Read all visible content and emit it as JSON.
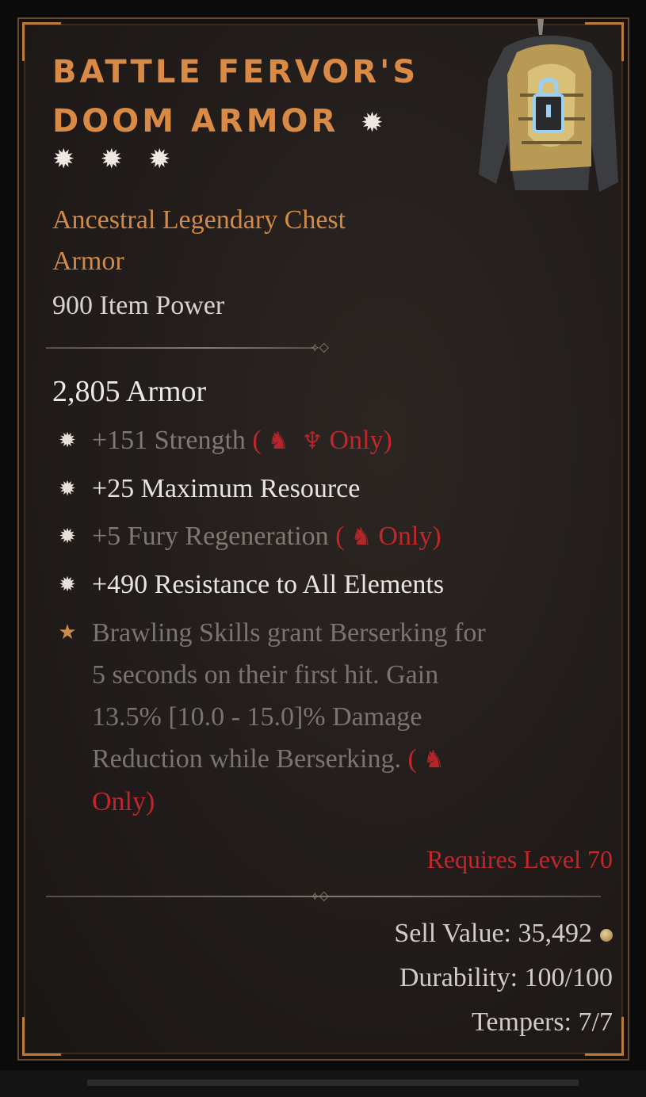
{
  "tooltip": {
    "title_line1": "BATTLE FERVOR'S",
    "title_line2": "DOOM ARMOR",
    "rarity_stars": [
      "✹",
      "✹",
      "✹"
    ],
    "title_star": "✹",
    "item_type_line1": "Ancestral Legendary Chest",
    "item_type_line2": "Armor",
    "item_power": "900 Item Power",
    "armor_value": "2,805 Armor",
    "divider_ornament": "⟡◇",
    "affixes": [
      {
        "text": "+151 Strength",
        "requirement": "Only)",
        "dimmed": true,
        "open_paren": "(",
        "icons": [
          "barbarian-helm-icon",
          "druid-claw-icon"
        ]
      },
      {
        "text": "+25 Maximum Resource",
        "dimmed": false
      },
      {
        "text": "+5 Fury Regeneration",
        "requirement": "Only)",
        "dimmed": true,
        "open_paren": "(",
        "icons": [
          "barbarian-helm-icon"
        ]
      },
      {
        "text": "+490 Resistance to All Elements",
        "dimmed": false
      }
    ],
    "legendary_affix": {
      "line1": "Brawling Skills grant Berserking for",
      "line2": "5 seconds on their first hit. Gain",
      "line3": "13.5% [10.0 - 15.0]% Damage",
      "line4": "Reduction while Berserking.",
      "open_paren": "(",
      "line5": "Only)"
    },
    "requires_level": "Requires Level 70",
    "sell_value": "Sell Value: 35,492",
    "durability": "Durability: 100/100",
    "tempers": "Tempers: 7/7",
    "colors": {
      "title": "#d98a45",
      "legendary_text": "#d18a47",
      "class_requirement": "#c1262b",
      "bright_text": "#e8e4e0",
      "dim_text": "#807873"
    }
  }
}
